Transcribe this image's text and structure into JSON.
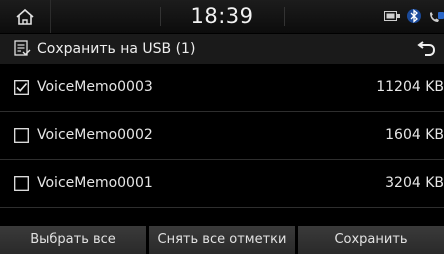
{
  "status": {
    "time": "18:39",
    "icons": [
      "usb-icon",
      "bluetooth-icon",
      "phone-signal-icon"
    ]
  },
  "header": {
    "title": "Сохранить на USB (1)",
    "icon": "save-list-icon",
    "back_icon": "back-icon"
  },
  "files": [
    {
      "name": "VoiceMemo0003",
      "size": "11204 KB",
      "checked": true
    },
    {
      "name": "VoiceMemo0002",
      "size": "1604 KB",
      "checked": false
    },
    {
      "name": "VoiceMemo0001",
      "size": "3204 KB",
      "checked": false
    }
  ],
  "actions": {
    "select_all": "Выбрать все",
    "deselect_all": "Снять все отметки",
    "save": "Сохранить"
  },
  "colors": {
    "background": "#000000",
    "bar": "#1a1a1a",
    "button": "#333333",
    "text": "#e8e8e8"
  }
}
